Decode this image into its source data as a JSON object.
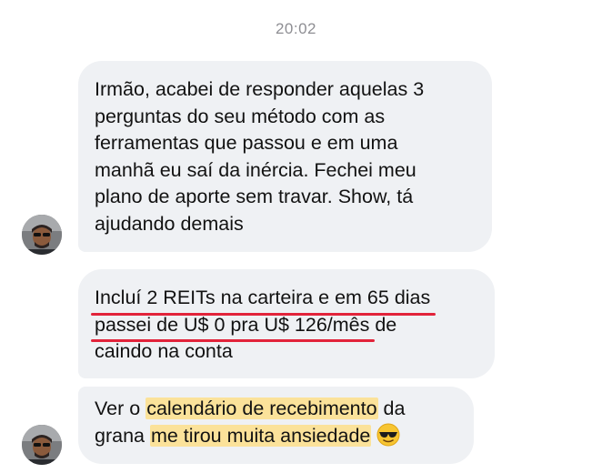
{
  "conversation": {
    "timestamp": "20:02",
    "messages": [
      {
        "lines": [
          "Irmão, acabei de responder aquelas 3",
          "perguntas do seu método com as",
          "ferramentas que passou e em uma",
          "manhã eu saí da inércia. Fechei meu",
          "plano de aporte sem travar. Show, tá",
          "ajudando demais"
        ]
      },
      {
        "underlined_line_1": "Incluí 2 REITs na carteira e em 65 dias",
        "underlined_line_2": "passei de U$ 0 pra U$ 126/mês",
        "line_2_rest": " de",
        "line_3": "caindo na conta"
      },
      {
        "line_1_prefix": "Ver o ",
        "line_1_highlight": "calendário de recebimento",
        "line_1_suffix": " da",
        "line_2_prefix": "grana ",
        "line_2_highlight": "me tirou muita ansiedade",
        "emoji": "smiling-face-with-sunglasses"
      }
    ]
  },
  "colors": {
    "bubble_bg": "#eff1f4",
    "underline": "#e2233a",
    "highlight": "#fbe29a",
    "timestamp": "#8e8e93"
  }
}
